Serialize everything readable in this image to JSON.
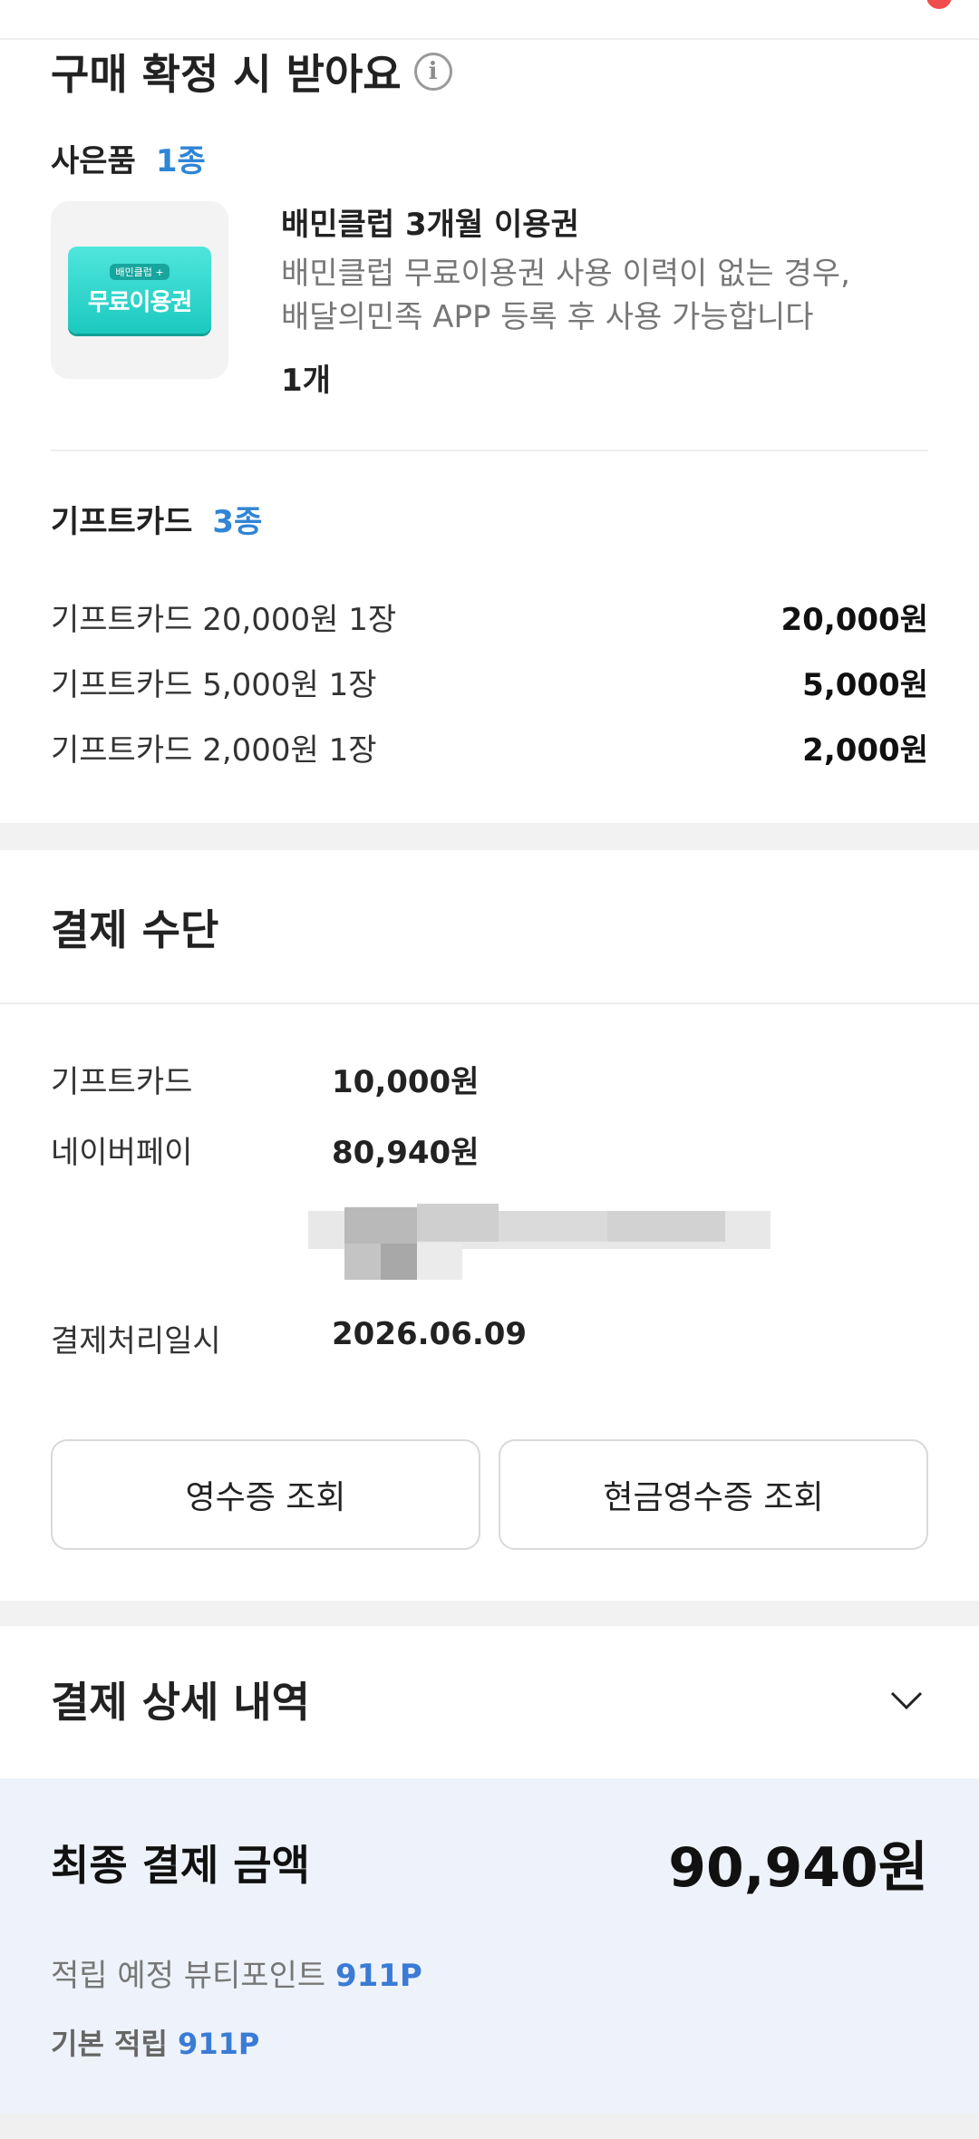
{
  "rewards": {
    "title": "구매 확정 시 받아요",
    "info_icon": "info-icon",
    "gift": {
      "label": "사은품",
      "count": "1종",
      "thumb_text_small": "배민클럽 +",
      "thumb_text_big": "무료이용권",
      "name": "배민클럽 3개월 이용권",
      "desc_line1": "배민클럽 무료이용권 사용 이력이 없는 경우,",
      "desc_line2": "배달의민족 APP 등록 후 사용 가능합니다",
      "qty": "1개"
    },
    "giftcards": {
      "label": "기프트카드",
      "count": "3종",
      "items": [
        {
          "name": "기프트카드 20,000원 1장",
          "amount": "20,000원"
        },
        {
          "name": "기프트카드 5,000원 1장",
          "amount": "5,000원"
        },
        {
          "name": "기프트카드 2,000원 1장",
          "amount": "2,000원"
        }
      ]
    }
  },
  "payment": {
    "title": "결제 수단",
    "rows": [
      {
        "label": "기프트카드",
        "value": "10,000원"
      },
      {
        "label": "네이버페이",
        "value": "80,940원"
      }
    ],
    "date_label": "결제처리일시",
    "date_value": "2026.06.09",
    "receipt_button": "영수증 조회",
    "cash_receipt_button": "현금영수증 조회"
  },
  "detail": {
    "title": "결제 상세 내역",
    "toggle_icon": "chevron-down-icon"
  },
  "final": {
    "label": "최종 결제 금액",
    "amount": "90,940원",
    "points_label": "적립 예정 뷰티포인트",
    "points_value": "911P",
    "basic_label": "기본 적립",
    "basic_value": "911P"
  },
  "colors": {
    "accent_blue": "#2f85d6",
    "points_blue": "#3a7bd5",
    "panel_bg": "#eef2fa"
  }
}
